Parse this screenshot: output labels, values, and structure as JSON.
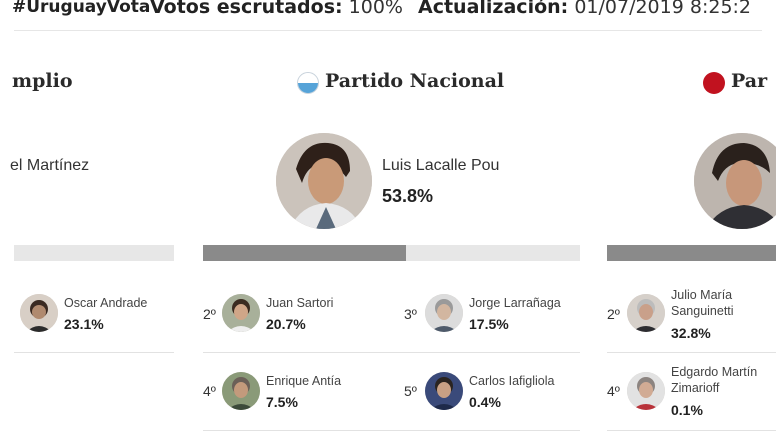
{
  "header": {
    "hashtag": "#UruguayVota",
    "votes_label": "Votos escrutados:",
    "votes_value": "100%",
    "update_label": "Actualización:",
    "update_value": "01/07/2019 8:25:2"
  },
  "left_party": {
    "title_fragment": "mplio",
    "winner_name": "el Martínez",
    "winner_pct": "",
    "winner_share": 0.0,
    "others": [
      {
        "rank": "",
        "name": "Oscar Andrade",
        "pct": "23.1%"
      }
    ]
  },
  "center_party": {
    "title": "Partido Nacional",
    "flag_color": "#56a3d8",
    "winner_name": "Luis Lacalle Pou",
    "winner_pct": "53.8%",
    "winner_share": 0.538,
    "others": [
      {
        "rank": "2º",
        "name": "Juan Sartori",
        "pct": "20.7%"
      },
      {
        "rank": "3º",
        "name": "Jorge Larrañaga",
        "pct": "17.5%"
      },
      {
        "rank": "4º",
        "name": "Enrique Antía",
        "pct": "7.5%"
      },
      {
        "rank": "5º",
        "name": "Carlos Iafigliola",
        "pct": "0.4%"
      }
    ]
  },
  "right_party": {
    "title_fragment": "Par",
    "flag_color": "#c1121f",
    "others": [
      {
        "rank": "2º",
        "name_line1": "Julio María",
        "name_line2": "Sanguinetti",
        "pct": "32.8%"
      },
      {
        "rank": "4º",
        "name_line1": "Edgardo Martín",
        "name_line2": "Zimarioff",
        "pct": "0.1%"
      }
    ]
  }
}
